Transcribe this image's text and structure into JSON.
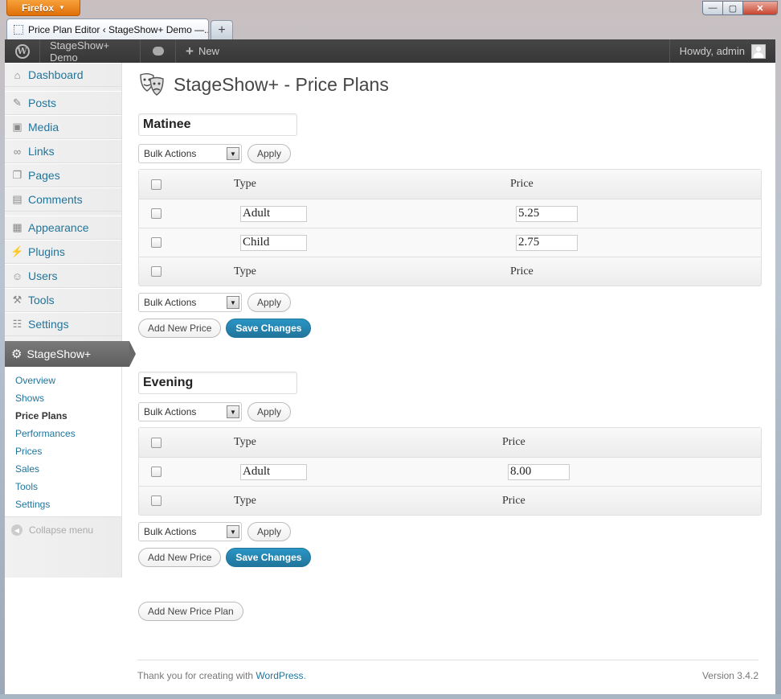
{
  "browser": {
    "menu_label": "Firefox",
    "tab_title": "Price Plan Editor ‹ StageShow+ Demo —...",
    "new_tab": "+",
    "controls": {
      "minimize": "—",
      "maximize": "▢",
      "close": "✕"
    }
  },
  "adminbar": {
    "site_name": "StageShow+ Demo",
    "new_label": "New",
    "howdy": "Howdy, admin"
  },
  "sidebar": {
    "items": [
      {
        "label": "Dashboard",
        "icon": "dashboard-icon"
      },
      {
        "label": "Posts",
        "icon": "pin-icon"
      },
      {
        "label": "Media",
        "icon": "media-icon"
      },
      {
        "label": "Links",
        "icon": "link-icon"
      },
      {
        "label": "Pages",
        "icon": "pages-icon"
      },
      {
        "label": "Comments",
        "icon": "comments-icon"
      },
      {
        "label": "Appearance",
        "icon": "appearance-icon"
      },
      {
        "label": "Plugins",
        "icon": "plugins-icon"
      },
      {
        "label": "Users",
        "icon": "users-icon"
      },
      {
        "label": "Tools",
        "icon": "tools-icon"
      },
      {
        "label": "Settings",
        "icon": "settings-icon"
      }
    ],
    "active": {
      "label": "StageShow+"
    },
    "submenu": [
      "Overview",
      "Shows",
      "Price Plans",
      "Performances",
      "Prices",
      "Sales",
      "Tools",
      "Settings"
    ],
    "collapse_label": "Collapse menu"
  },
  "page": {
    "title": "StageShow+ - Price Plans",
    "bulk_actions": "Bulk Actions",
    "apply": "Apply",
    "add_new_price": "Add New Price",
    "save_changes": "Save Changes",
    "add_new_price_plan": "Add New Price Plan",
    "col_type": "Type",
    "col_price": "Price",
    "plans": [
      {
        "name": "Matinee",
        "prices": [
          {
            "type": "Adult",
            "price": "5.25"
          },
          {
            "type": "Child",
            "price": "2.75"
          }
        ]
      },
      {
        "name": "Evening",
        "prices": [
          {
            "type": "Adult",
            "price": "8.00"
          }
        ]
      }
    ]
  },
  "footer": {
    "thanks_prefix": "Thank you for creating with",
    "wordpress_link": "WordPress",
    "thanks_suffix": ".",
    "version": "Version 3.4.2"
  }
}
